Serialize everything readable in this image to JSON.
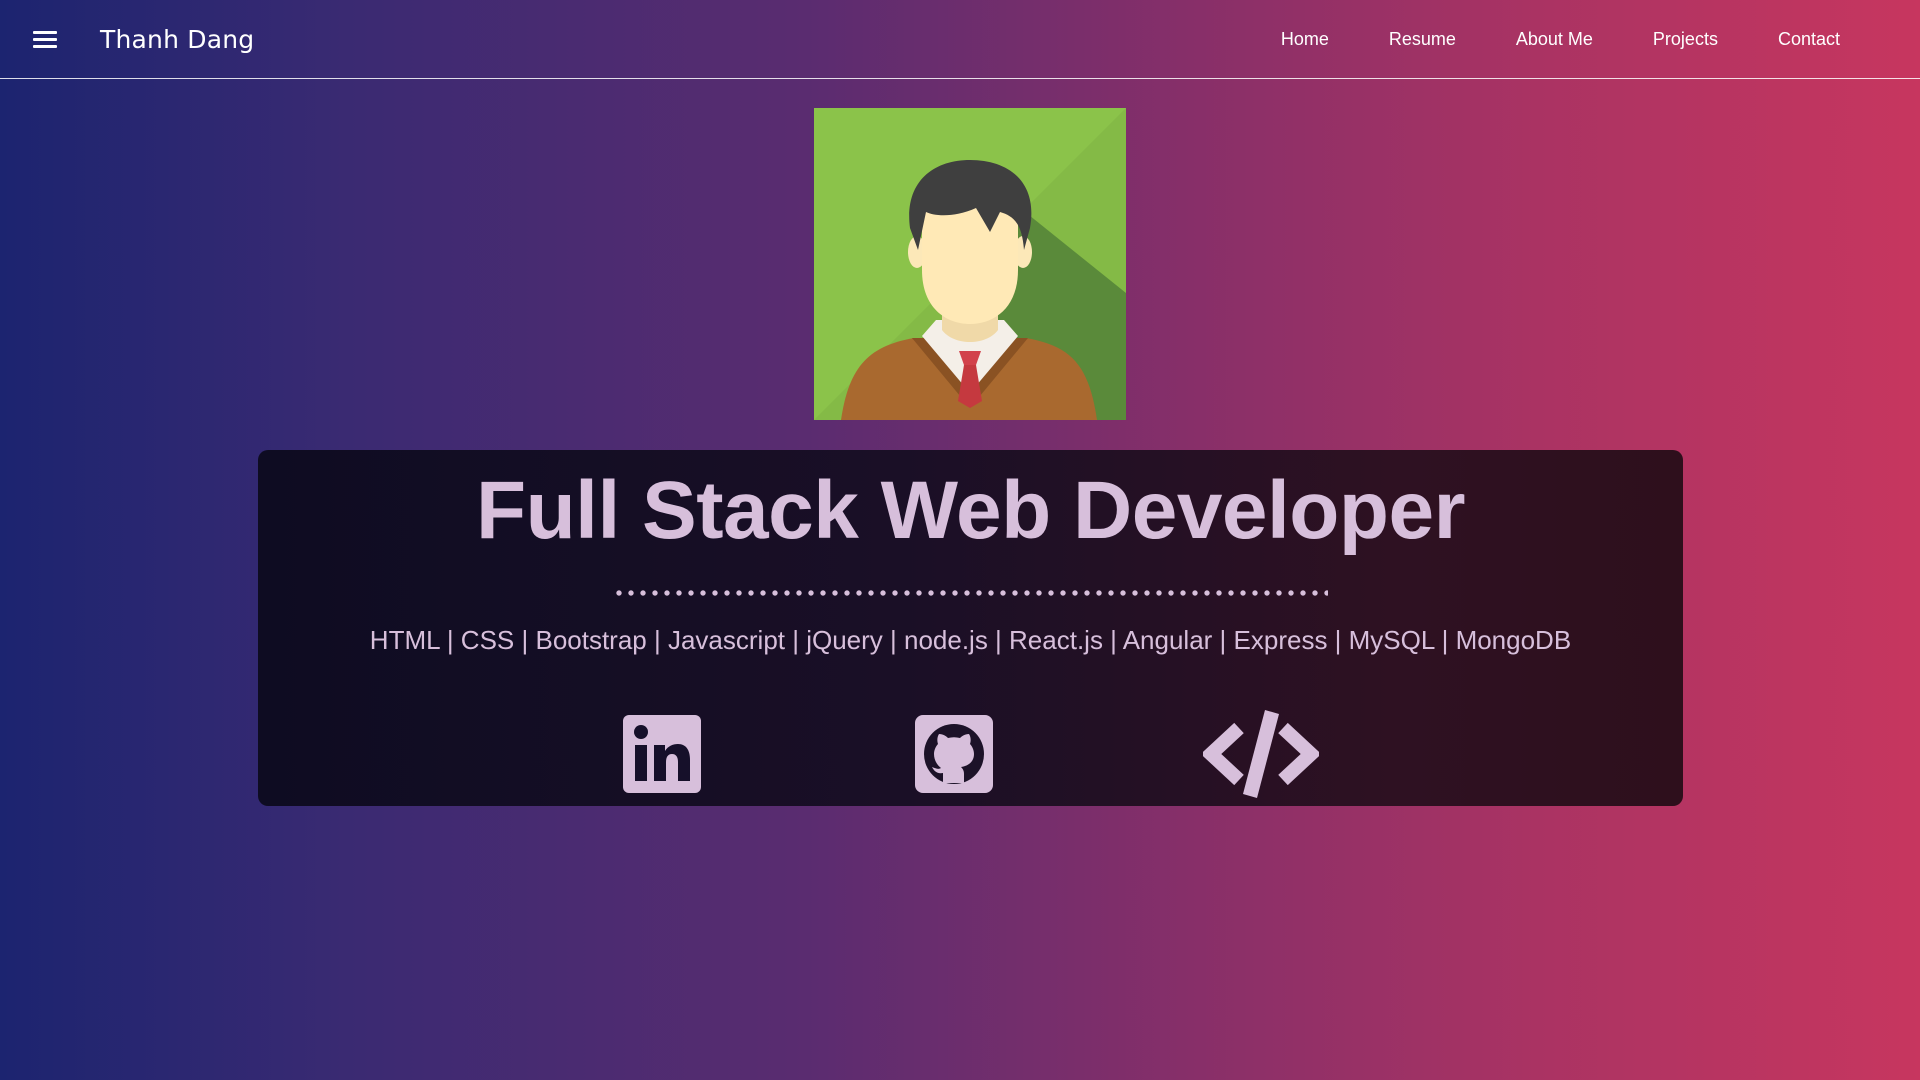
{
  "nav": {
    "brand": "Thanh Dang",
    "links": [
      "Home",
      "Resume",
      "About Me",
      "Projects",
      "Contact"
    ]
  },
  "hero": {
    "title": "Full Stack Web Developer",
    "skills": "HTML | CSS | Bootstrap | Javascript | jQuery | node.js | React.js | Angular | Express | MySQL | MongoDB"
  },
  "icons": {
    "menu": "menu-icon",
    "avatar": "avatar-image",
    "social": [
      "linkedin-icon",
      "github-icon",
      "code-icon"
    ]
  },
  "colors": {
    "accent_text": "#d7bfdb",
    "gradient_left": "#1c2470",
    "gradient_right": "#c7365f",
    "panel": "#140e22"
  }
}
